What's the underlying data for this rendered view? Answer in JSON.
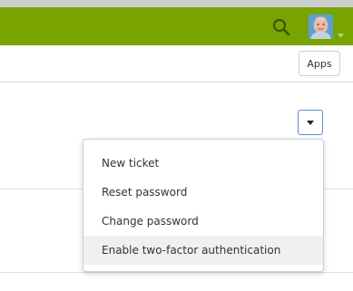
{
  "header": {
    "background_color": "#78a300",
    "search_icon": "search-icon",
    "avatar_icon": "user-avatar",
    "avatar_caret_icon": "caret-down-icon"
  },
  "subbar": {
    "apps_label": "Apps"
  },
  "actions_toggle": {
    "icon": "caret-down-icon",
    "border_color": "#5b8fd6"
  },
  "menu": {
    "items": [
      {
        "label": "New ticket"
      },
      {
        "label": "Reset password"
      },
      {
        "label": "Change password"
      },
      {
        "label": "Enable two-factor authentication",
        "highlighted": true
      }
    ]
  }
}
